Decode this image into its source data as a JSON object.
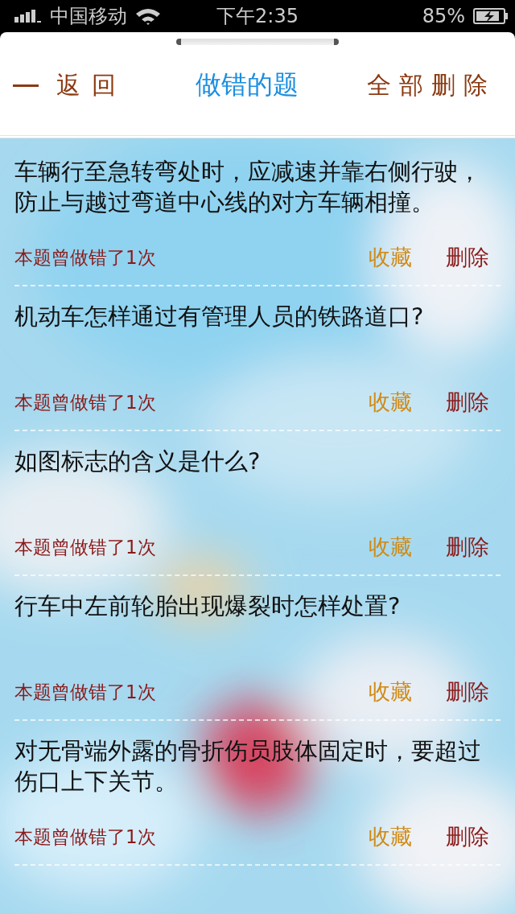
{
  "status_bar": {
    "carrier": "中国移动",
    "time": "下午2:35",
    "battery": "85%"
  },
  "header": {
    "back": "返回",
    "title": "做错的题",
    "delete_all": "全部删除"
  },
  "questions": [
    {
      "text": "车辆行至急转弯处时，应减速并靠右侧行驶，防止与越过弯道中心线的对方车辆相撞。",
      "mistakes": "本题曾做错了1次",
      "favorite": "收藏",
      "delete": "删除"
    },
    {
      "text": "机动车怎样通过有管理人员的铁路道口?",
      "mistakes": "本题曾做错了1次",
      "favorite": "收藏",
      "delete": "删除"
    },
    {
      "text": "如图标志的含义是什么?",
      "mistakes": "本题曾做错了1次",
      "favorite": "收藏",
      "delete": "删除"
    },
    {
      "text": "行车中左前轮胎出现爆裂时怎样处置?",
      "mistakes": "本题曾做错了1次",
      "favorite": "收藏",
      "delete": "删除"
    },
    {
      "text": "对无骨端外露的骨折伤员肢体固定时，要超过伤口上下关节。",
      "mistakes": "本题曾做错了1次",
      "favorite": "收藏",
      "delete": "删除"
    }
  ]
}
